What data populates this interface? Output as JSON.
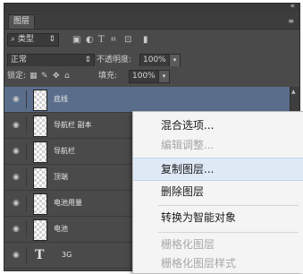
{
  "panel": {
    "close_glyph": "«",
    "tab_label": "图层",
    "menu_glyph": "≡"
  },
  "filter_row": {
    "filter_value": "类型",
    "icons": [
      "image-filter-icon",
      "adjustment-filter-icon",
      "text-filter-icon",
      "shape-filter-icon",
      "smartobject-filter-icon",
      "filter-toggle-icon"
    ]
  },
  "blend_row": {
    "blend_mode": "正常",
    "opacity_label": "不透明度:",
    "opacity_value": "100%"
  },
  "lock_row": {
    "lock_label": "锁定:",
    "fill_label": "填充:",
    "fill_value": "100%"
  },
  "layers": [
    {
      "name": "底线",
      "selected": true,
      "kind": "pixel"
    },
    {
      "name": "导航栏 副本",
      "selected": false,
      "kind": "pixel"
    },
    {
      "name": "导航栏",
      "selected": false,
      "kind": "pixel"
    },
    {
      "name": "顶端",
      "selected": false,
      "kind": "pixel"
    },
    {
      "name": "电池用量",
      "selected": false,
      "kind": "pixel"
    },
    {
      "name": "电池",
      "selected": false,
      "kind": "pixel"
    },
    {
      "name": "3G",
      "selected": false,
      "kind": "text",
      "glyph": "T"
    }
  ],
  "context_menu": {
    "items": [
      {
        "label": "混合选项...",
        "disabled": false,
        "highlighted": false
      },
      {
        "label": "编辑调整...",
        "disabled": true,
        "highlighted": false
      },
      {
        "label": "复制图层...",
        "disabled": false,
        "highlighted": true
      },
      {
        "label": "删除图层",
        "disabled": false,
        "highlighted": false
      },
      {
        "label": "转换为智能对象",
        "disabled": false,
        "highlighted": false
      },
      {
        "label": "栅格化图层",
        "disabled": true,
        "highlighted": false
      },
      {
        "label": "栅格化图层样式",
        "disabled": true,
        "highlighted": false
      }
    ]
  },
  "colors": {
    "panel_bg": "#4a4a4a",
    "selected_layer": "#5a6e8c",
    "menu_bg": "#f4f4f4",
    "menu_highlight": "#dfe9f6",
    "disabled_text": "#a7a7a7"
  }
}
